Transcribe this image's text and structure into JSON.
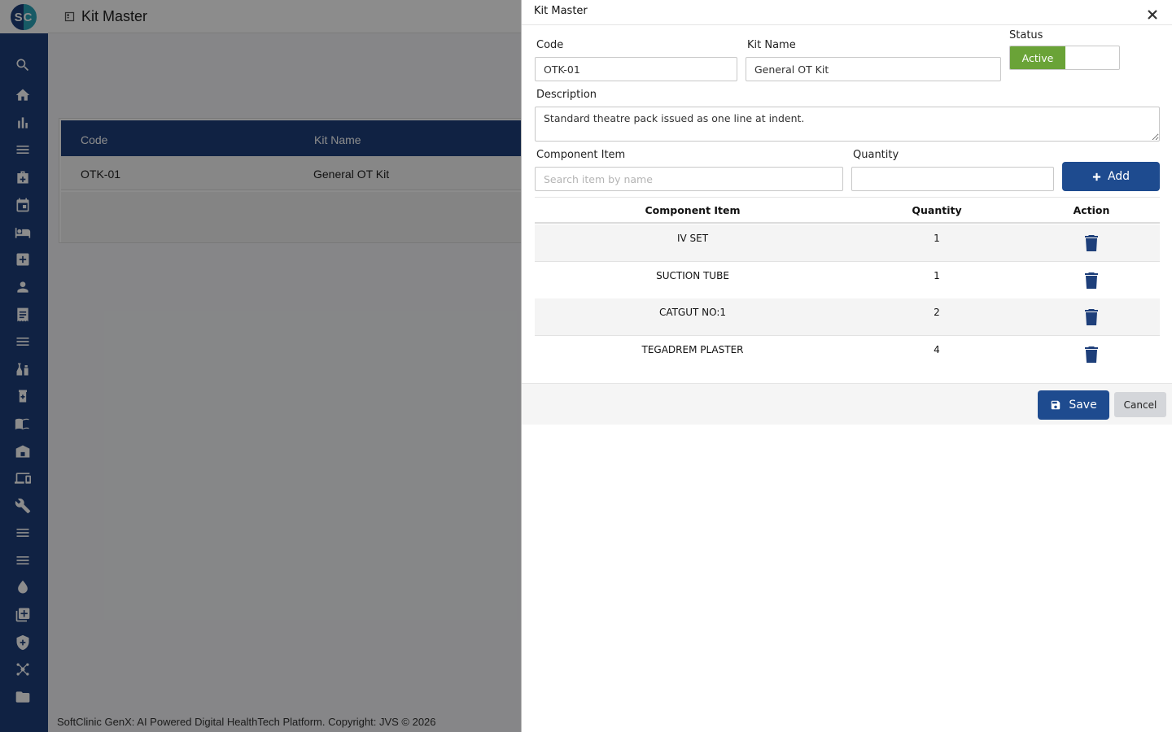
{
  "app": {
    "logo_text": "SC",
    "page_title": "Kit Master",
    "footer_text": "SoftClinic GenX: AI Powered Digital HealthTech Platform. Copyright: JVS © 2026",
    "grid": {
      "columns": [
        "Code",
        "Kit Name"
      ],
      "rows": [
        [
          "OTK-01",
          "General OT Kit"
        ]
      ]
    },
    "sidebar_icons": [
      "search-icon",
      "home-icon",
      "bar-chart-icon",
      "menu-icon",
      "medical-bag-icon",
      "calendar-icon",
      "bed-icon",
      "plus-box-icon",
      "person-icon",
      "receipt-icon",
      "menu-icon",
      "lab-icon",
      "medicine-icon",
      "book-icon",
      "store-icon",
      "devices-icon",
      "wrench-icon",
      "menu-icon",
      "menu-icon",
      "drop-icon",
      "add-library-icon",
      "shield-icon",
      "network-icon",
      "folder-icon"
    ]
  },
  "drawer": {
    "title": "Kit Master",
    "form": {
      "code_label": "Code",
      "code_value": "OTK-01",
      "kit_name_label": "Kit Name",
      "kit_name_value": "General OT Kit",
      "status_label": "Status",
      "status_value": "Active",
      "description_label": "Description",
      "description_value": "Standard theatre pack issued as one line at indent.",
      "component_label": "Component Item",
      "component_placeholder": "Search item by name",
      "quantity_label": "Quantity",
      "quantity_value": "",
      "add_label": "Add"
    },
    "components": {
      "headers": [
        "Component Item",
        "Quantity",
        "Action"
      ],
      "rows": [
        {
          "item": "IV SET",
          "qty": "1"
        },
        {
          "item": "SUCTION TUBE",
          "qty": "1"
        },
        {
          "item": "CATGUT NO:1",
          "qty": "2"
        },
        {
          "item": "TEGADREM PLASTER",
          "qty": "4"
        }
      ]
    },
    "footer": {
      "save_label": "Save",
      "cancel_label": "Cancel"
    }
  },
  "colors": {
    "primary": "#1e3f7a",
    "button": "#1e4b8f",
    "active_status": "#6aa337"
  }
}
